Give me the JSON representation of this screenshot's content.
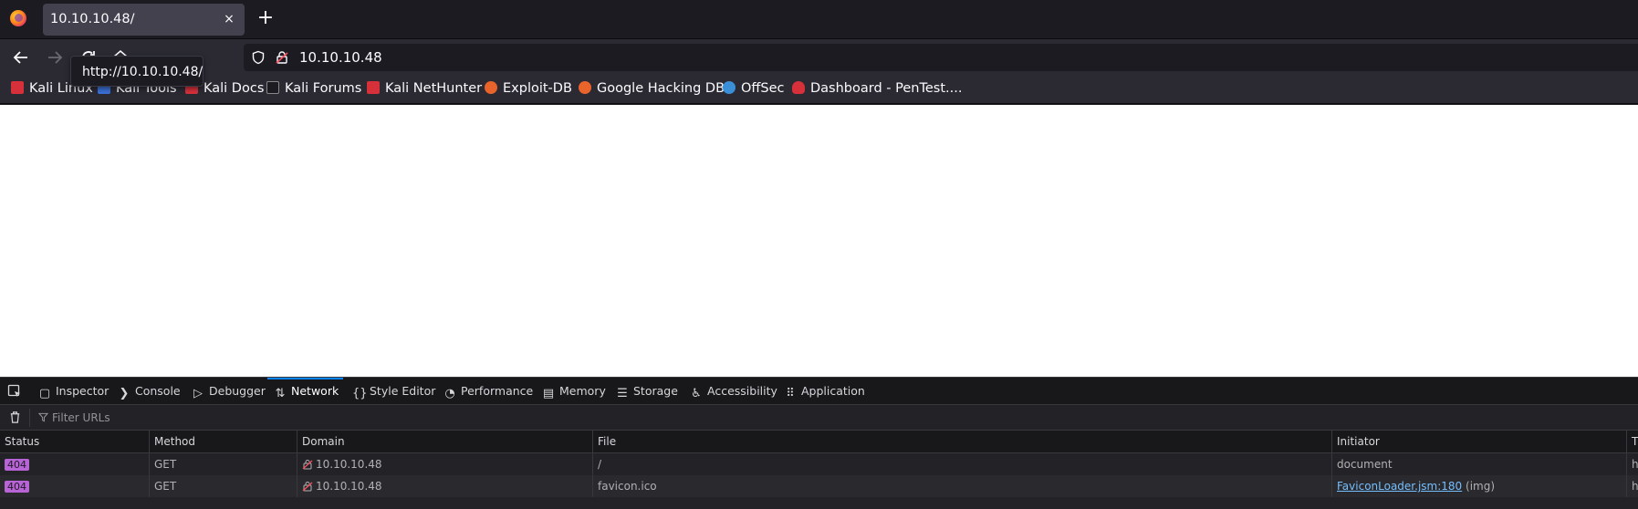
{
  "browser": {
    "tab": {
      "title": "10.10.10.48/",
      "close": "×"
    },
    "new_tab": "+",
    "url": "10.10.10.48",
    "tooltip": "http://10.10.10.48/",
    "bookmarks": [
      {
        "label": "Kali Linux",
        "icon": "kali-icon"
      },
      {
        "label": "Kali Tools",
        "icon": "kali-tools-icon"
      },
      {
        "label": "Kali Docs",
        "icon": "kali-docs-icon"
      },
      {
        "label": "Kali Forums",
        "icon": "kali-forums-icon"
      },
      {
        "label": "Kali NetHunter",
        "icon": "nethunter-icon"
      },
      {
        "label": "Exploit-DB",
        "icon": "exploitdb-icon"
      },
      {
        "label": "Google Hacking DB",
        "icon": "ghdb-icon"
      },
      {
        "label": "OffSec",
        "icon": "offsec-icon"
      },
      {
        "label": "Dashboard - PenTest....",
        "icon": "pentest-icon"
      }
    ]
  },
  "devtools": {
    "tabs": [
      {
        "label": "Inspector",
        "icon": "inspector-icon"
      },
      {
        "label": "Console",
        "icon": "console-icon"
      },
      {
        "label": "Debugger",
        "icon": "debugger-icon"
      },
      {
        "label": "Network",
        "icon": "network-icon",
        "active": true
      },
      {
        "label": "Style Editor",
        "icon": "style-editor-icon"
      },
      {
        "label": "Performance",
        "icon": "performance-icon"
      },
      {
        "label": "Memory",
        "icon": "memory-icon"
      },
      {
        "label": "Storage",
        "icon": "storage-icon"
      },
      {
        "label": "Accessibility",
        "icon": "accessibility-icon"
      },
      {
        "label": "Application",
        "icon": "application-icon"
      }
    ],
    "filter_placeholder": "Filter URLs",
    "columns": [
      "Status",
      "Method",
      "Domain",
      "File",
      "Initiator",
      "T"
    ],
    "rows": [
      {
        "status": "404",
        "method": "GET",
        "domain": "10.10.10.48",
        "file": "/",
        "initiator": "document",
        "initiator_extra": "",
        "t": "h"
      },
      {
        "status": "404",
        "method": "GET",
        "domain": "10.10.10.48",
        "file": "favicon.ico",
        "initiator": "FaviconLoader.jsm:180",
        "initiator_extra": "(img)",
        "t": "h"
      }
    ],
    "colors": {
      "status_404": "#b863d6",
      "active_tab": "#0a84ff"
    }
  }
}
